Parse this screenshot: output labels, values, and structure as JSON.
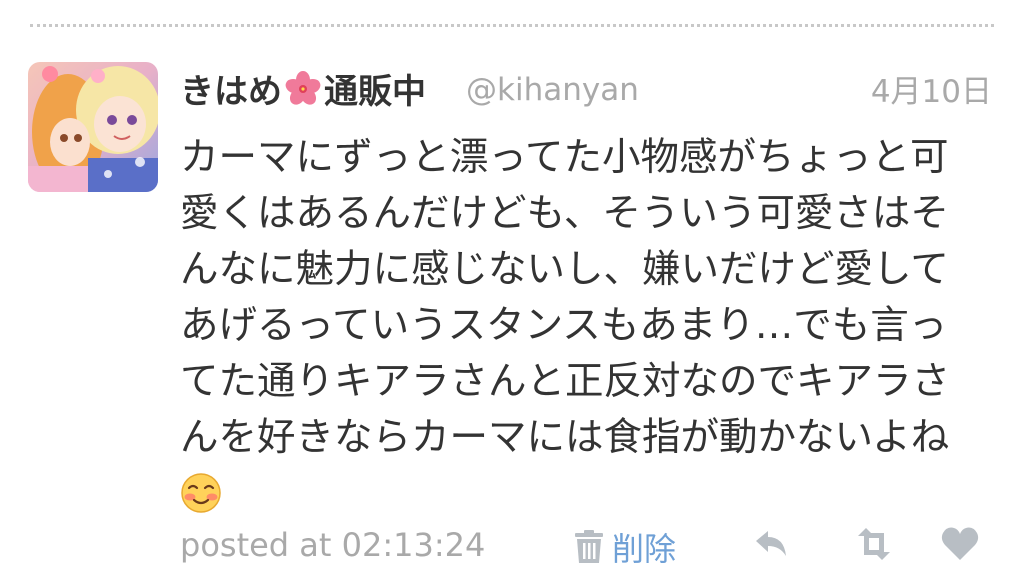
{
  "tweet": {
    "author": {
      "name_prefix": "きはめ",
      "name_suffix": "通販中",
      "username": "@kihanyan"
    },
    "date": "4月10日",
    "lines": [
      "カーマにずっと漂ってた小物感がちょっと可",
      "愛くはあるんだけども、そういう可愛さはそ",
      "んなに魅力に感じないし、嫌いだけど愛して",
      "あげるっていうスタンスもあまり…でも言っ",
      "てた通りキアラさんと正反対なのでキアラさ",
      "んを好きならカーマには食指が動かないよね"
    ],
    "emoji": "smiling-blushing-face-icon"
  },
  "footer": {
    "posted_at": "posted at 02:13:24",
    "delete_label": "削除"
  },
  "icons": {
    "name_flower": "hibiscus-icon",
    "delete": "trash-icon",
    "reply": "reply-icon",
    "retweet": "retweet-icon",
    "favorite": "heart-icon"
  },
  "colors": {
    "text": "#333333",
    "muted": "#a9a9a9",
    "link": "#6fa0d6",
    "icon": "#b8bec4"
  }
}
